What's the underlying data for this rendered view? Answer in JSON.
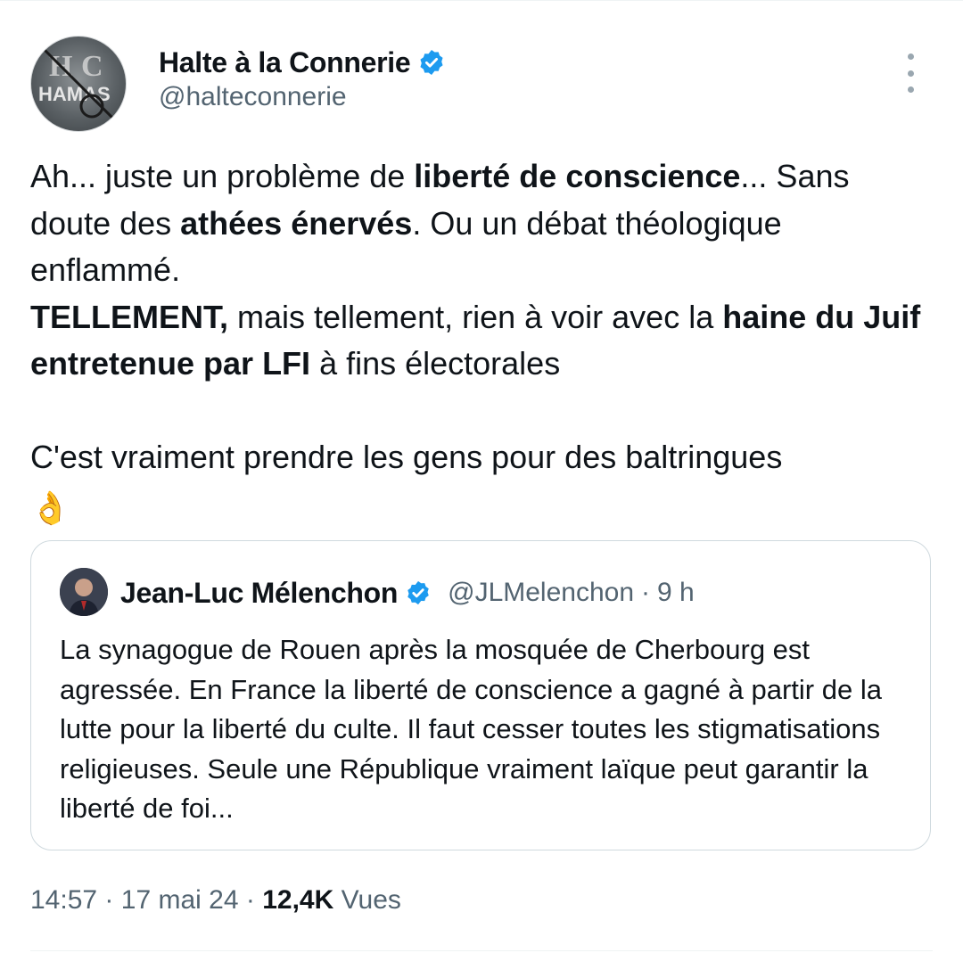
{
  "author": {
    "name": "Halte à la Connerie",
    "handle": "@halteconnerie",
    "avatar_icon": "hamas-crossed-avatar",
    "avatar_text": "HAMAS",
    "verified_icon": "verified-badge-icon"
  },
  "tweet": {
    "lines": [
      [
        "Ah... juste un problème de ",
        "liberté de conscience",
        "... Sans doute des ",
        "athées énervés",
        ". Ou un débat théologique enflammé."
      ],
      [
        "TELLEMENT,",
        " mais tellement, rien à voir avec la ",
        "haine du Juif entretenue par LFI",
        " à fins électorales"
      ],
      [
        "C'est vraiment prendre les gens pour des baltringues"
      ]
    ],
    "emoji": "👌"
  },
  "quoted": {
    "name": "Jean-Luc Mélenchon",
    "handle": "@JLMelenchon",
    "separator": "·",
    "time": "9 h",
    "text": "La synagogue de Rouen après la mosquée de Cherbourg est agressée. En France la liberté de conscience a gagné à partir de la lutte pour la liberté du culte. Il faut cesser toutes les stigmatisations religieuses. Seule une République vraiment laïque peut garantir la liberté de foi..."
  },
  "meta": {
    "time": "14:57",
    "sep1": "·",
    "date": "17 mai 24",
    "sep2": "·",
    "views_count": "12,4K",
    "views_label": "Vues"
  },
  "colors": {
    "verified": "#1d9bf0",
    "secondary_text": "#536471",
    "border": "#cfd9de"
  }
}
